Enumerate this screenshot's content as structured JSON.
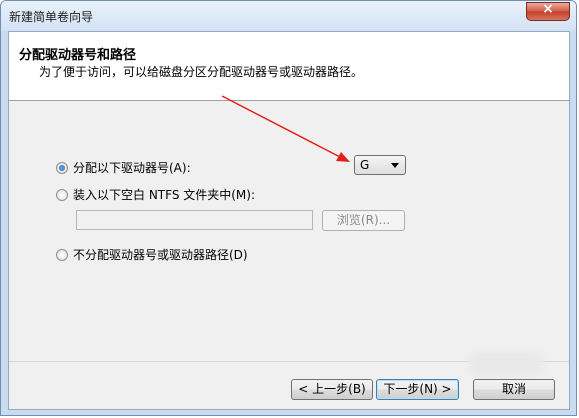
{
  "window": {
    "title": "新建简单卷向导",
    "close_label": "×"
  },
  "header": {
    "title": "分配驱动器号和路径",
    "subtitle": "为了便于访问，可以给磁盘分区分配驱动器号或驱动器路径。"
  },
  "options": {
    "assign_letter_label": "分配以下驱动器号(A):",
    "mount_folder_label": "装入以下空白 NTFS 文件夹中(M):",
    "no_assign_label": "不分配驱动器号或驱动器路径(D)",
    "selected": "assign_letter"
  },
  "drive_select": {
    "value": "G"
  },
  "folder_path": {
    "value": "",
    "browse_label": "浏览(R)..."
  },
  "buttons": {
    "back_label": "< 上一步(B)",
    "next_label": "下一步(N) >",
    "cancel_label": "取消"
  },
  "colors": {
    "annotation_arrow": "#e0201a",
    "title_bar": "#d3e2f3"
  }
}
